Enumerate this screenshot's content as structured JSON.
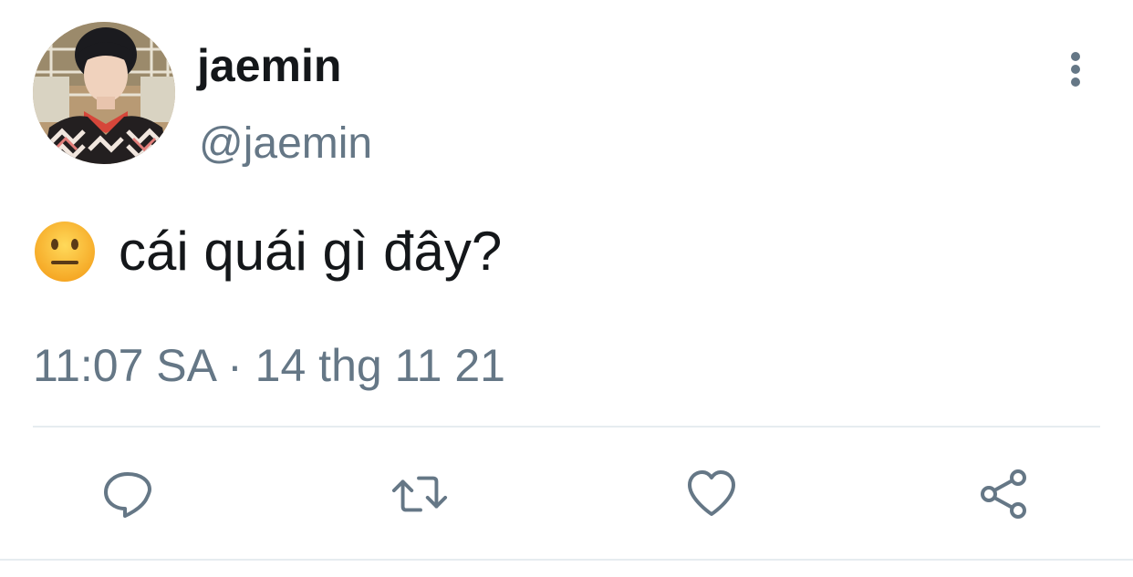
{
  "user": {
    "display_name": "jaemin",
    "handle": "@jaemin"
  },
  "tweet": {
    "emoji": "neutral-face-emoji",
    "text": "cái quái gì đây?",
    "timestamp": "11:07 SA · 14 thg 11 21"
  },
  "actions": [
    "reply-icon",
    "retweet-icon",
    "like-icon",
    "share-icon"
  ],
  "colors": {
    "primary_text": "#14171a",
    "secondary_text": "#657786",
    "icon": "#657786",
    "divider": "#e6ecf0",
    "emoji_face": "#ffc83d"
  }
}
